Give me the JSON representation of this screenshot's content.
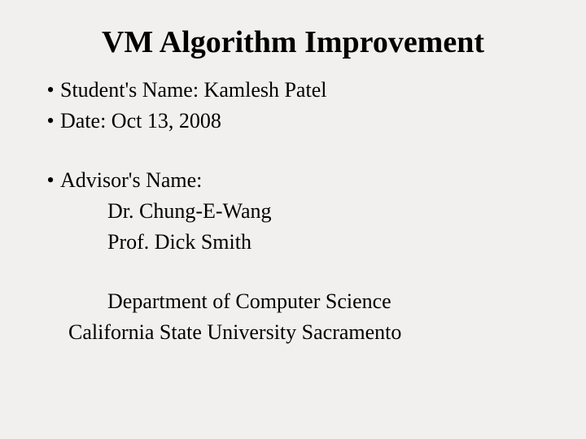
{
  "title": "VM Algorithm Improvement",
  "bullets": {
    "student": "Student's Name: Kamlesh  Patel",
    "date": "Date: Oct 13, 2008",
    "advisor_label": "Advisor's Name:"
  },
  "advisors": {
    "line1": "Dr. Chung-E-Wang",
    "line2": "Prof. Dick Smith"
  },
  "department": "Department of Computer Science",
  "university": "California State University Sacramento"
}
